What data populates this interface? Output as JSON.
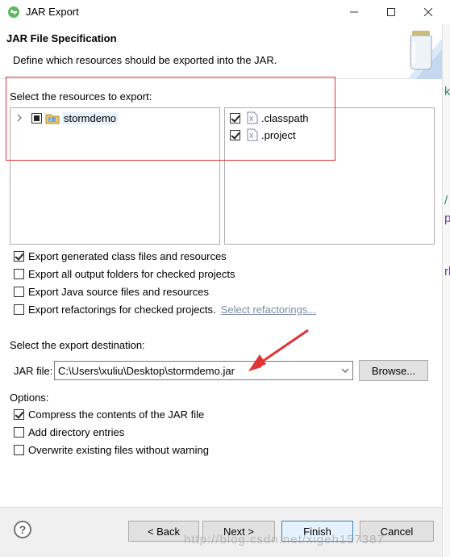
{
  "window": {
    "title": "JAR Export"
  },
  "header": {
    "title": "JAR File Specification",
    "description": "Define which resources should be exported into the JAR."
  },
  "resources": {
    "label": "Select the resources to export:",
    "tree": [
      {
        "label": "stormdemo",
        "state": "partial",
        "icon": "java-project-icon"
      }
    ],
    "files": [
      {
        "label": ".classpath",
        "checked": true,
        "icon": "xml-file-icon"
      },
      {
        "label": ".project",
        "checked": true,
        "icon": "xml-file-icon"
      }
    ]
  },
  "options_top": [
    {
      "label": "Export generated class files and resources",
      "checked": true
    },
    {
      "label": "Export all output folders for checked projects",
      "checked": false
    },
    {
      "label": "Export Java source files and resources",
      "checked": false
    },
    {
      "label": "Export refactorings for checked projects.",
      "checked": false,
      "link": "Select refactorings..."
    }
  ],
  "destination": {
    "label": "Select the export destination:",
    "jar_label": "JAR file:",
    "jar_value": "C:\\Users\\xuliu\\Desktop\\stormdemo.jar",
    "browse": "Browse..."
  },
  "options": {
    "label": "Options:",
    "items": [
      {
        "label": "Compress the contents of the JAR file",
        "checked": true
      },
      {
        "label": "Add directory entries",
        "checked": false
      },
      {
        "label": "Overwrite existing files without warning",
        "checked": false
      }
    ]
  },
  "buttons": {
    "back": "< Back",
    "next": "Next >",
    "finish": "Finish",
    "cancel": "Cancel"
  },
  "watermark": "http://blog.csdn.net/xigeh157387",
  "colors": {
    "annotation": "#e03535",
    "link": "#7a8aa6",
    "default_button_border": "#3c7fb1"
  }
}
